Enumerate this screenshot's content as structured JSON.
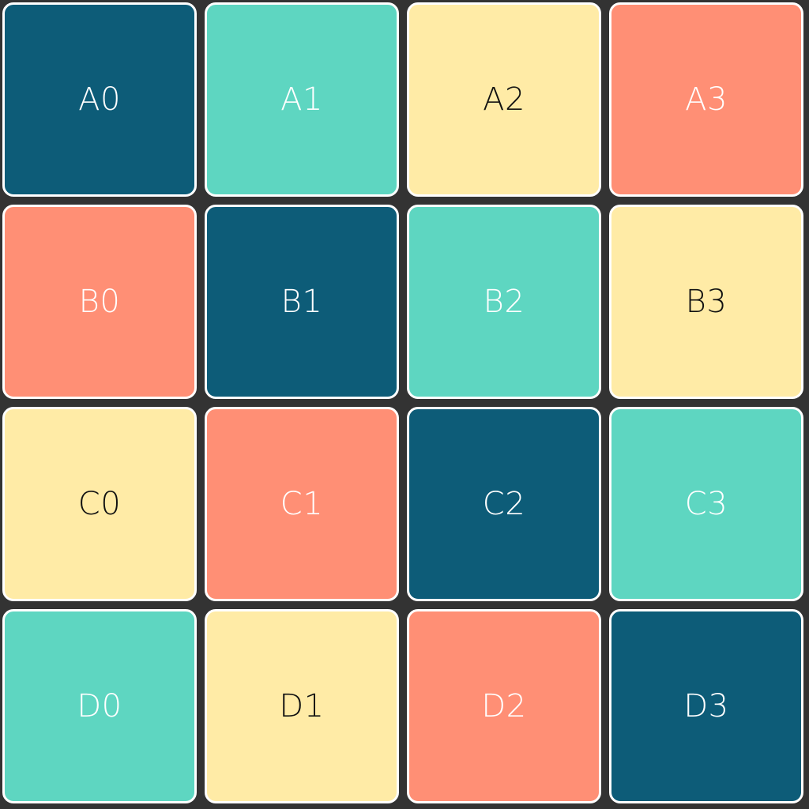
{
  "colors": {
    "navy": "#0d5c78",
    "teal": "#5ed6c1",
    "cream": "#ffeba6",
    "salmon": "#ff8f75",
    "text_light": "#ffffff",
    "text_dark": "#111111",
    "background": "#333333",
    "border": "#ffffff"
  },
  "tiles": [
    {
      "label": "A0",
      "fill": "#0d5c78",
      "text": "#ffffff"
    },
    {
      "label": "A1",
      "fill": "#5ed6c1",
      "text": "#ffffff"
    },
    {
      "label": "A2",
      "fill": "#ffeba6",
      "text": "#111111"
    },
    {
      "label": "A3",
      "fill": "#ff8f75",
      "text": "#ffffff"
    },
    {
      "label": "B0",
      "fill": "#ff8f75",
      "text": "#ffffff"
    },
    {
      "label": "B1",
      "fill": "#0d5c78",
      "text": "#ffffff"
    },
    {
      "label": "B2",
      "fill": "#5ed6c1",
      "text": "#ffffff"
    },
    {
      "label": "B3",
      "fill": "#ffeba6",
      "text": "#111111"
    },
    {
      "label": "C0",
      "fill": "#ffeba6",
      "text": "#111111"
    },
    {
      "label": "C1",
      "fill": "#ff8f75",
      "text": "#ffffff"
    },
    {
      "label": "C2",
      "fill": "#0d5c78",
      "text": "#ffffff"
    },
    {
      "label": "C3",
      "fill": "#5ed6c1",
      "text": "#ffffff"
    },
    {
      "label": "D0",
      "fill": "#5ed6c1",
      "text": "#ffffff"
    },
    {
      "label": "D1",
      "fill": "#ffeba6",
      "text": "#111111"
    },
    {
      "label": "D2",
      "fill": "#ff8f75",
      "text": "#ffffff"
    },
    {
      "label": "D3",
      "fill": "#0d5c78",
      "text": "#ffffff"
    }
  ]
}
